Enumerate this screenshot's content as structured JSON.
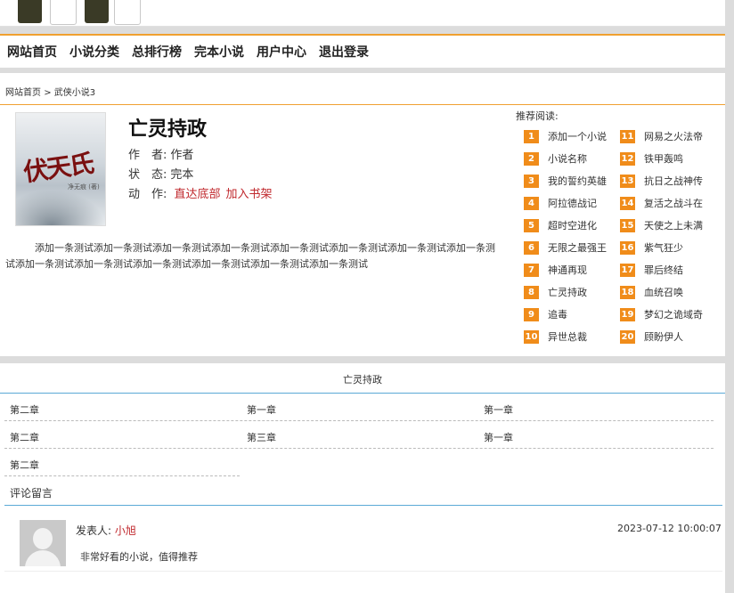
{
  "nav": {
    "items": [
      "网站首页",
      "小说分类",
      "总排行榜",
      "完本小说",
      "用户中心",
      "退出登录"
    ]
  },
  "breadcrumb": {
    "home": "网站首页",
    "separator": ">",
    "category": "武侠小说3"
  },
  "book": {
    "cover_text": "伏天氏",
    "cover_subtext": "净无痕 (著)",
    "title": "亡灵持政",
    "author_label": "作　者:",
    "author": "作者",
    "status_label": "状　态:",
    "status": "完本",
    "action_label": "动　作:",
    "action_bottom": "直达底部",
    "action_shelf": "加入书架",
    "description": "添加一条测试添加一条测试添加一条测试添加一条测试添加一条测试添加一条测试添加一条测试添加一条测试添加一条测试添加一条测试添加一条测试添加一条测试添加一条测试添加一条测试"
  },
  "recommend": {
    "title": "推荐阅读:",
    "left": [
      {
        "n": "1",
        "t": "添加一个小说"
      },
      {
        "n": "2",
        "t": "小说名称"
      },
      {
        "n": "3",
        "t": "我的誓约英雄"
      },
      {
        "n": "4",
        "t": "阿拉德战记"
      },
      {
        "n": "5",
        "t": "超时空进化"
      },
      {
        "n": "6",
        "t": "无限之最强王"
      },
      {
        "n": "7",
        "t": "神通再现"
      },
      {
        "n": "8",
        "t": "亡灵持政"
      },
      {
        "n": "9",
        "t": "追毒"
      },
      {
        "n": "10",
        "t": "异世总裁"
      }
    ],
    "right": [
      {
        "n": "11",
        "t": "网易之火法帝"
      },
      {
        "n": "12",
        "t": "铁甲轰鸣"
      },
      {
        "n": "13",
        "t": "抗日之战神传"
      },
      {
        "n": "14",
        "t": "复活之战斗在"
      },
      {
        "n": "15",
        "t": "天使之上未满"
      },
      {
        "n": "16",
        "t": "紫气狂少"
      },
      {
        "n": "17",
        "t": "罪后终结"
      },
      {
        "n": "18",
        "t": "血统召唤"
      },
      {
        "n": "19",
        "t": "梦幻之诡域奇"
      },
      {
        "n": "20",
        "t": "顾盼伊人"
      }
    ]
  },
  "chapters": {
    "heading": "亡灵持政",
    "list": [
      "第二章",
      "第一章",
      "第一章",
      "第二章",
      "第三章",
      "第一章",
      "第二章"
    ]
  },
  "comments": {
    "title": "评论留言",
    "poster_label": "发表人:",
    "poster": "小旭",
    "time": "2023-07-12 10:00:07",
    "text": "非常好看的小说，值得推荐"
  }
}
